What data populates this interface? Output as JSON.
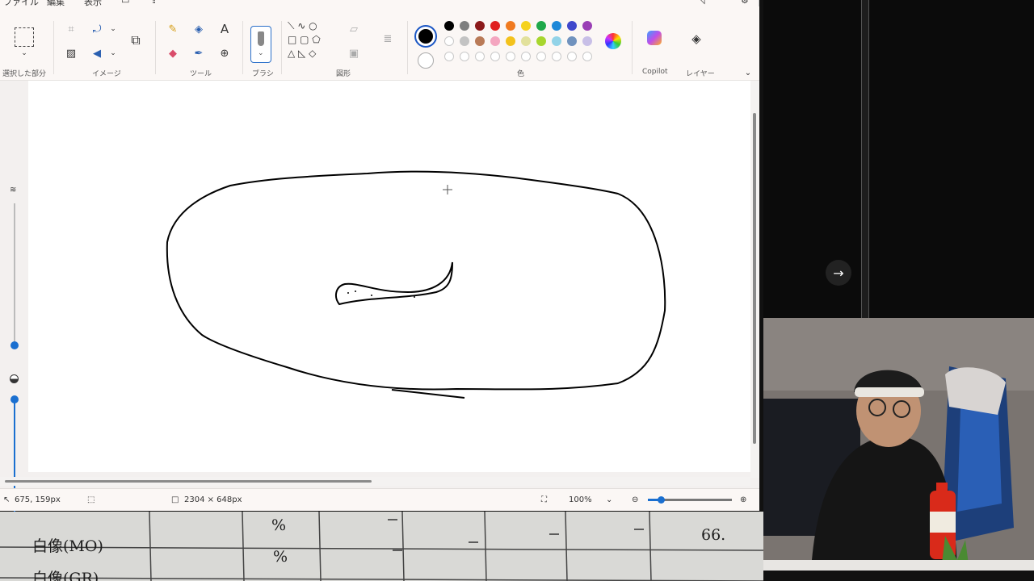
{
  "menu": {
    "file": "ファイル",
    "edit": "編集",
    "view": "表示"
  },
  "ribbon": {
    "groups": {
      "selection": "選択した部分",
      "image": "イメージ",
      "tools": "ツール",
      "brushes": "ブラシ",
      "shapes": "図形",
      "colors": "色",
      "copilot": "Copilot",
      "layers": "レイヤー"
    },
    "palette_row1": [
      "#000000",
      "#7f7f7f",
      "#8b1a1a",
      "#e02020",
      "#f07a20",
      "#f5d21c",
      "#1fa84a",
      "#1e88d8",
      "#3f48cc",
      "#9a3fb5"
    ],
    "palette_row2": [
      "#ffffff",
      "#c3c3c3",
      "#b97a57",
      "#f4a6c0",
      "#f3c21c",
      "#e2e19c",
      "#a7d62e",
      "#92d3e8",
      "#7092be",
      "#c8bfe7"
    ]
  },
  "status": {
    "cursor_position": "675, 159px",
    "canvas_size": "2304 × 648px",
    "zoom": "100%"
  },
  "paper": {
    "row1_label": "白像(MO)",
    "row2_label": "白像(GR)",
    "unit1": "%",
    "unit2": "%",
    "value": "66."
  }
}
